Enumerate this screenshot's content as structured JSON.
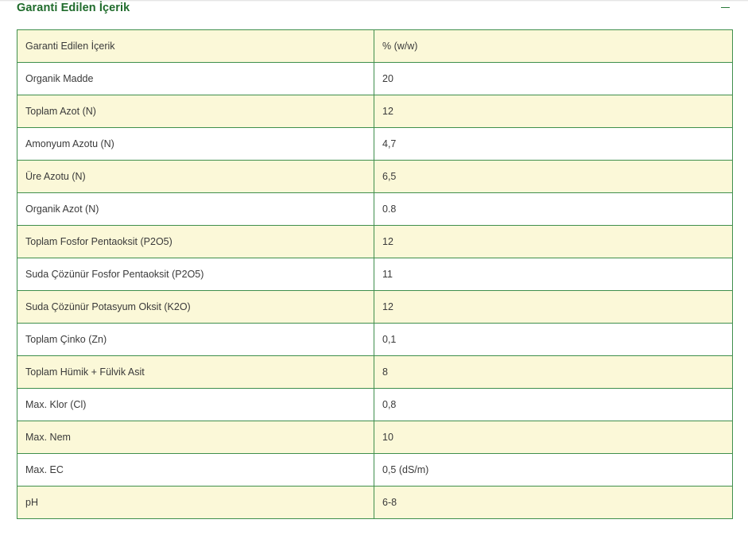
{
  "section": {
    "title": "Garanti Edilen İçerik",
    "toggle_icon": "minus-icon"
  },
  "colors": {
    "title": "#1f6b2b",
    "border": "#3f8f4c",
    "stripe": "#fbf8d8",
    "text": "#3a3a3a"
  },
  "table": {
    "header": {
      "name": "Garanti Edilen İçerik",
      "value": "% (w/w)"
    },
    "rows": [
      {
        "name": "Organik Madde",
        "value": "20"
      },
      {
        "name": "Toplam Azot (N)",
        "value": "12"
      },
      {
        "name": "Amonyum Azotu (N)",
        "value": "4,7"
      },
      {
        "name": "Üre Azotu (N)",
        "value": "6,5"
      },
      {
        "name": "Organik Azot (N)",
        "value": "0.8"
      },
      {
        "name": "Toplam Fosfor Pentaoksit (P2O5)",
        "value": "12"
      },
      {
        "name": "Suda Çözünür Fosfor Pentaoksit (P2O5)",
        "value": "11"
      },
      {
        "name": "Suda Çözünür Potasyum Oksit (K2O)",
        "value": "12"
      },
      {
        "name": "Toplam Çinko (Zn)",
        "value": "0,1"
      },
      {
        "name": "Toplam Hümik + Fülvik Asit",
        "value": "8"
      },
      {
        "name": "Max. Klor (Cl)",
        "value": "0,8"
      },
      {
        "name": "Max. Nem",
        "value": "10"
      },
      {
        "name": "Max. EC",
        "value": "0,5 (dS/m)"
      },
      {
        "name": "pH",
        "value": "6-8"
      }
    ]
  }
}
